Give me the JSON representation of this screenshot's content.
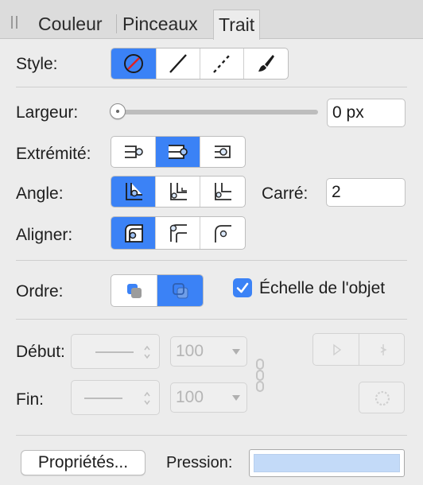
{
  "tabs": [
    {
      "label": "Couleur"
    },
    {
      "label": "Pinceaux"
    },
    {
      "label": "Trait",
      "active": true
    }
  ],
  "style": {
    "label": "Style:",
    "options": [
      "no-stroke-icon",
      "solid-line-icon",
      "dashed-line-icon",
      "brush-stroke-icon"
    ],
    "selected": 0
  },
  "largeur": {
    "label": "Largeur:",
    "value": "0 px",
    "slider_fraction": 0
  },
  "extremite": {
    "label": "Extrémité:",
    "options": [
      "butt-cap-icon",
      "round-cap-icon",
      "square-cap-icon"
    ],
    "selected": 1
  },
  "angle": {
    "label": "Angle:",
    "options": [
      "miter-join-icon",
      "round-join-icon",
      "bevel-join-icon"
    ],
    "selected": 0,
    "carre_label": "Carré:",
    "carre_value": "2"
  },
  "aligner": {
    "label": "Aligner:",
    "options": [
      "align-inside-icon",
      "align-center-icon",
      "align-outside-icon"
    ],
    "selected": 0
  },
  "ordre": {
    "label": "Ordre:",
    "options": [
      "stroke-behind-icon",
      "stroke-front-icon"
    ],
    "selected": 1
  },
  "echelle": {
    "label": "Échelle de l'objet",
    "checked": true
  },
  "debut": {
    "label": "Début:",
    "size": "100"
  },
  "fin": {
    "label": "Fin:",
    "size": "100"
  },
  "proprietes": {
    "label": "Propriétés..."
  },
  "pression": {
    "label": "Pression:"
  },
  "colors": {
    "accent": "#3b82f6",
    "pressure_fill": "#c3daf8"
  }
}
